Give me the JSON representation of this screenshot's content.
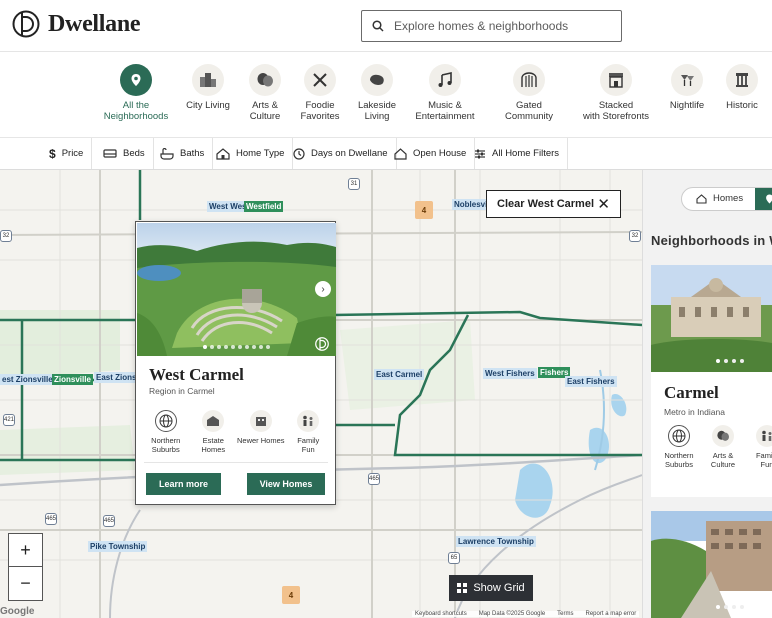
{
  "app": {
    "name": "Dwellane"
  },
  "search": {
    "placeholder": "Explore homes & neighborhoods"
  },
  "categories": [
    {
      "label": "All the\nNeighborhoods",
      "icon": "map-pin-icon",
      "active": true
    },
    {
      "label": "City Living",
      "icon": "city-icon"
    },
    {
      "label": "Arts &\nCulture",
      "icon": "theater-masks-icon"
    },
    {
      "label": "Foodie\nFavorites",
      "icon": "utensils-icon"
    },
    {
      "label": "Lakeside\nLiving",
      "icon": "lake-icon"
    },
    {
      "label": "Music &\nEntertainment",
      "icon": "music-note-icon"
    },
    {
      "label": "Gated\nCommunity",
      "icon": "gate-icon"
    },
    {
      "label": "Stacked\nwith Storefronts",
      "icon": "storefront-icon"
    },
    {
      "label": "Nightlife",
      "icon": "cocktail-icon"
    },
    {
      "label": "Historic",
      "icon": "column-icon"
    }
  ],
  "filters": [
    {
      "label": "Price",
      "icon": "dollar-icon"
    },
    {
      "label": "Beds",
      "icon": "bed-icon"
    },
    {
      "label": "Baths",
      "icon": "bathtub-icon"
    },
    {
      "label": "Home Type",
      "icon": "house-icon"
    },
    {
      "label": "Days on Dwellane",
      "icon": "clock-icon"
    },
    {
      "label": "Open House",
      "icon": "open-house-icon"
    },
    {
      "label": "All Home Filters",
      "icon": "sliders-icon"
    }
  ],
  "map": {
    "clear_label": "Clear West Carmel",
    "labels": {
      "west_west": "West Wes",
      "westfield": "Westfield",
      "noblesville": "Noblesville",
      "west_zionsville": "est Zionsville",
      "zionsville": "Zionsville",
      "east_zions": "East Zions",
      "east_carmel": "East Carmel",
      "west_fishers": "West Fishers",
      "fishers": "Fishers",
      "east_fishers": "East Fishers",
      "pike_township": "Pike Township",
      "lawrence_township": "Lawrence Township"
    },
    "clusters": [
      "4",
      "4"
    ],
    "highways": [
      "32",
      "31",
      "32",
      "421",
      "465",
      "465",
      "65",
      "465"
    ],
    "zoom_in": "+",
    "zoom_out": "−",
    "show_grid_label": "Show Grid",
    "google": "Google",
    "attribution": [
      "Keyboard shortcuts",
      "Map Data ©2025 Google",
      "Terms",
      "Report a map error"
    ]
  },
  "popup": {
    "title": "West Carmel",
    "subtitle": "Region in Carmel",
    "tags": [
      {
        "label": "Northern\nSuburbs",
        "icon": "globe-icon"
      },
      {
        "label": "Estate\nHomes",
        "icon": "estate-icon"
      },
      {
        "label": "Newer Homes",
        "icon": "new-building-icon"
      },
      {
        "label": "Family\nFun",
        "icon": "family-icon"
      }
    ],
    "learn_more": "Learn more",
    "view_homes": "View Homes"
  },
  "panel": {
    "toggle_homes": "Homes",
    "title": "Neighborhoods in W",
    "cards": [
      {
        "title": "Carmel",
        "subtitle": "Metro in Indiana",
        "tags": [
          {
            "label": "Northern\nSuburbs",
            "icon": "globe-icon"
          },
          {
            "label": "Arts &\nCulture",
            "icon": "theater-masks-icon"
          },
          {
            "label": "Family\nFun",
            "icon": "family-icon"
          }
        ]
      }
    ]
  },
  "colors": {
    "brand_green": "#2b6b56",
    "map_bg": "#f4f3ef",
    "water": "#a9d4ee",
    "boundary": "#2a7557"
  }
}
